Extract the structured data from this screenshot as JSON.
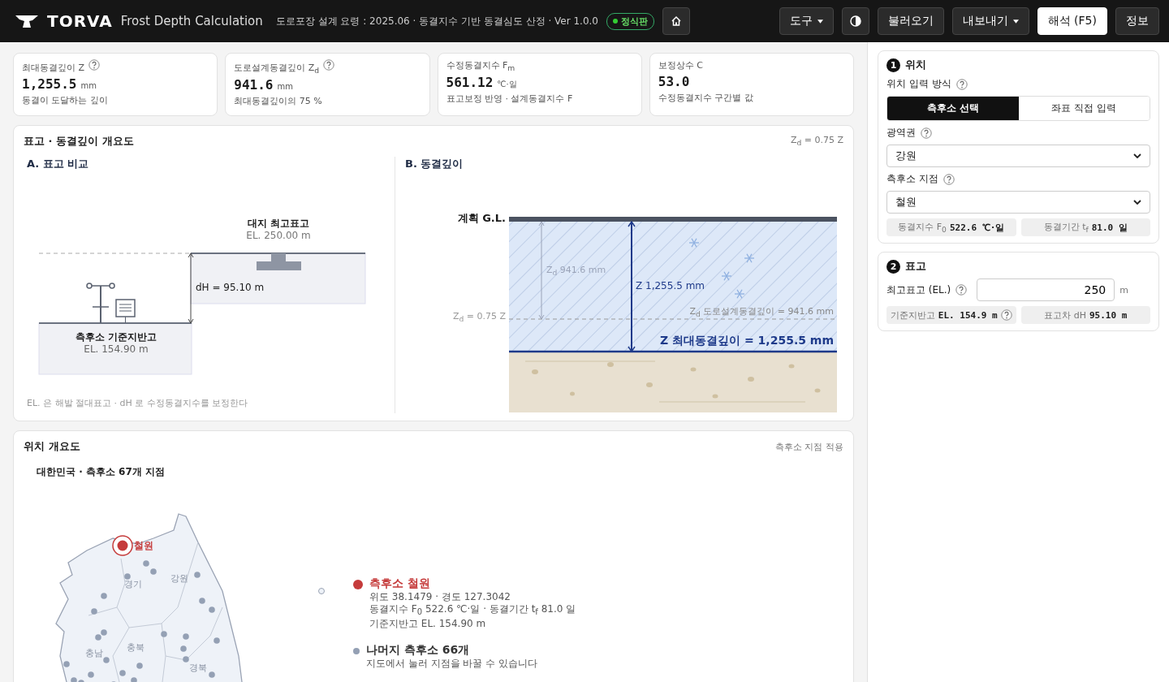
{
  "header": {
    "logo": "TORVA",
    "subtitle": "Frost Depth Calculation",
    "info": "도로포장 설계 요령 : 2025.06 · 동결지수 기반 동결심도 산정 · Ver 1.0.0",
    "badge": "정식판",
    "buttons": [
      {
        "kind": "menu",
        "label": "도구"
      },
      {
        "kind": "theme"
      },
      {
        "kind": "plain",
        "label": "불러오기"
      },
      {
        "kind": "menu",
        "label": "내보내기"
      },
      {
        "kind": "primary",
        "label": "해석 (F5)"
      },
      {
        "kind": "plain",
        "label": "정보"
      }
    ]
  },
  "stats": [
    {
      "label": "최대동결깊이 Z",
      "help": true,
      "value": "1,255.5",
      "unit": "mm",
      "note": "동결이 도달하는 깊이"
    },
    {
      "label": "도로설계동결깊이 Z$_{d}$",
      "help": true,
      "value": "941.6",
      "unit": "mm",
      "note": "최대동결깊이의 75 %"
    },
    {
      "label": "수정동결지수 F$_{m}$",
      "help": false,
      "value": "561.12",
      "unit": "℃·일",
      "note": "표고보정 반영 · 설계동결지수 F"
    },
    {
      "label": "보정상수 C",
      "help": false,
      "value": "53.0",
      "note": "수정동결지수 구간별 값"
    }
  ],
  "overview": {
    "title": "표고 · 동결깊이 개요도",
    "note": "Z$_{d}$ = 0.75 Z",
    "elevation": {
      "title": "A. 표고 비교",
      "site_label": "대지 최고표고",
      "site_el": "EL. 250.00 m",
      "dh": "dH = 95.10 m",
      "station_label": "측후소 기준지반고",
      "station_el": "EL. 154.90 m",
      "footnote": "EL. 은 해발 절대표고 · dH 로 수정동결지수를 보정한다"
    },
    "depth": {
      "title": "B. 동결깊이",
      "gl": "계획 G.L.",
      "zd_axis": "Z$_{d}$ = 0.75 Z",
      "zd_dim": "Z$_{d}$ 941.6 mm",
      "z_dim": "Z 1,255.5 mm",
      "zd_line": "Z$_{d}$ 도로설계동결깊이 = 941.6 mm",
      "z_line": "Z 최대동결깊이 = 1,255.5 mm"
    }
  },
  "location": {
    "title": "위치 개요도",
    "action": "측후소 지점 적용",
    "map_title": "대한민국 · 측후소 67개 지점",
    "regions": [
      "경기",
      "강원",
      "충남",
      "충북",
      "경북"
    ],
    "station": "철원",
    "selected": {
      "title": "측후소 철원",
      "color": "#c53b3b",
      "lines": [
        "위도 38.1479 · 경도 127.3042",
        "동결지수 F$_{0}$ 522.6 ℃·일 · 동결기간 t$_{f}$ 81.0 일",
        "기준지반고 EL. 154.90 m"
      ]
    },
    "others": {
      "title": "나머지 측후소 66개",
      "color": "#94a0b4",
      "note": "지도에서 눌러 지점을 바꿀 수 있습니다"
    }
  },
  "panel": {
    "location": {
      "step": "1",
      "title": "위치",
      "mode_label": "위치 입력 방식",
      "modes": [
        {
          "label": "측후소 선택",
          "selected": true
        },
        {
          "label": "좌표 직접 입력",
          "selected": false
        }
      ],
      "region_label": "광역권",
      "region": "강원",
      "station_label": "측후소 지점",
      "station": "철원",
      "chips": [
        {
          "label": "동결지수 F$_{0}$",
          "value": "522.6 ℃·일"
        },
        {
          "label": "동결기간 t$_{f}$",
          "value": "81.0 일"
        }
      ]
    },
    "elevation": {
      "step": "2",
      "title": "표고",
      "field_label": "최고표고 (EL.)",
      "value": "250",
      "unit": "m",
      "chips": [
        {
          "label": "기준지반고",
          "value": "EL. 154.9 m",
          "help": true
        },
        {
          "label": "표고차 dH",
          "value": "95.10 m",
          "help": false
        }
      ]
    }
  }
}
